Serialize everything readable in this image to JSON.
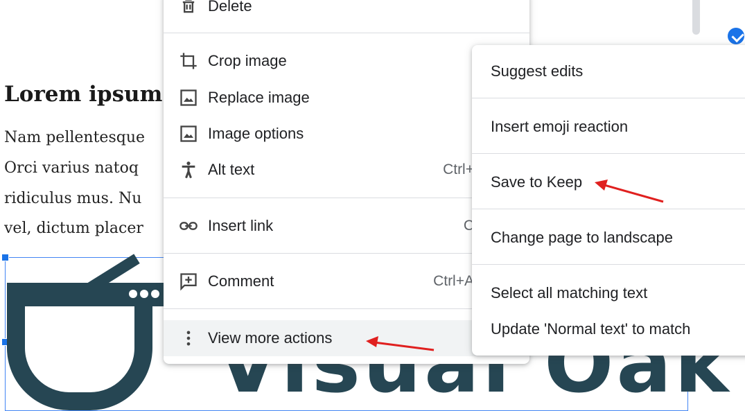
{
  "document": {
    "heading": "Lorem ipsum",
    "lines": [
      "Nam pellentesque",
      "Orci varius natoq",
      "ridiculus mus. Nu",
      "vel, dictum placer"
    ],
    "logo_text": "Visual Oak"
  },
  "context_menu": {
    "items": [
      {
        "label": "Delete",
        "icon": "trash-icon",
        "shortcut": ""
      },
      {
        "label": "Crop image",
        "icon": "crop-icon",
        "shortcut": ""
      },
      {
        "label": "Replace image",
        "icon": "image-icon",
        "shortcut": ""
      },
      {
        "label": "Image options",
        "icon": "image-icon",
        "shortcut": ""
      },
      {
        "label": "Alt text",
        "icon": "accessibility-icon",
        "shortcut": "Ctrl+"
      },
      {
        "label": "Insert link",
        "icon": "link-icon",
        "shortcut": "C"
      },
      {
        "label": "Comment",
        "icon": "add-comment-icon",
        "shortcut": "Ctrl+A"
      },
      {
        "label": "View more actions",
        "icon": "more-vert-icon",
        "shortcut": ""
      }
    ]
  },
  "submenu": {
    "items": [
      {
        "label": "Suggest edits"
      },
      {
        "label": "Insert emoji reaction"
      },
      {
        "label": "Save to Keep"
      },
      {
        "label": "Change page to landscape"
      },
      {
        "label": "Select all matching text"
      },
      {
        "label": "Update 'Normal text' to match"
      }
    ]
  },
  "colors": {
    "annotation_arrow": "#e0201f",
    "selection_blue": "#1a73e8",
    "logo_navy": "#264653",
    "hover_bg": "#f1f3f4"
  }
}
